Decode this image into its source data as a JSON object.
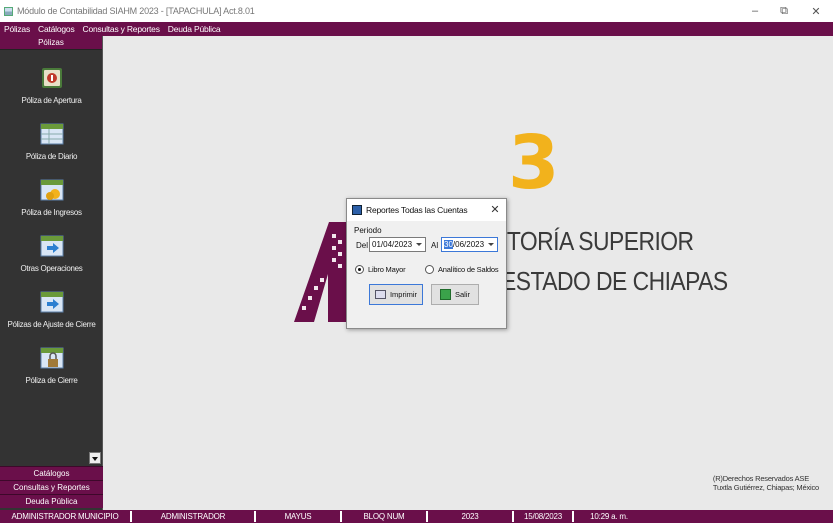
{
  "window": {
    "title": "Módulo de Contabilidad SIAHM 2023 - [TAPACHULA] Act.8.01",
    "minimize": "–",
    "maximize": "⧉",
    "close": "✕"
  },
  "menubar": {
    "items": [
      "Pólizas",
      "Catálogos",
      "Consultas y Reportes",
      "Deuda Pública"
    ]
  },
  "sidebar": {
    "header": "Pólizas",
    "items": [
      {
        "label": "Póliza de Apertura",
        "icon": "apertura-icon"
      },
      {
        "label": "Póliza de Diario",
        "icon": "diario-icon"
      },
      {
        "label": "Póliza de Ingresos",
        "icon": "ingresos-icon"
      },
      {
        "label": "Otras Operaciones",
        "icon": "operaciones-icon"
      },
      {
        "label": "Pólizas de Ajuste de Cierre",
        "icon": "ajuste-icon"
      },
      {
        "label": "Póliza de Cierre",
        "icon": "cierre-icon"
      }
    ],
    "bottom": [
      "Catálogos",
      "Consultas y Reportes",
      "Deuda Pública"
    ]
  },
  "background": {
    "logo_number": "3",
    "org_line1": "ITORÍA SUPERIOR",
    "org_line2": "ESTADO DE CHIAPAS",
    "rights_line1": "(R)Derechos Reservados ASE",
    "rights_line2": "Tuxtla Gutiérrez, Chiapas; México"
  },
  "dialog": {
    "title": "Reportes Todas las Cuentas",
    "close": "✕",
    "period_label": "Periodo",
    "from_label": "Del",
    "from_value": "01/04/2023",
    "to_label": "Al",
    "to_value_selected": "30",
    "to_value_rest": "/06/2023",
    "radio_libro": "Libro Mayor",
    "radio_analitico": "Analítico de Saldos",
    "radio_selected": "Libro Mayor",
    "print_button": "Imprimir",
    "exit_button": "Salir"
  },
  "statusbar": {
    "cells": [
      "ADMINISTRADOR MUNICIPIO",
      "ADMINISTRADOR",
      "MAYUS",
      "BLOQ NUM",
      "2023",
      "15/08/2023",
      "10:29 a. m."
    ]
  },
  "colors": {
    "brand": "#6a0f4a",
    "sidebar": "#333333",
    "logo_gold": "#f2b21c",
    "selection": "#3c78d8"
  }
}
